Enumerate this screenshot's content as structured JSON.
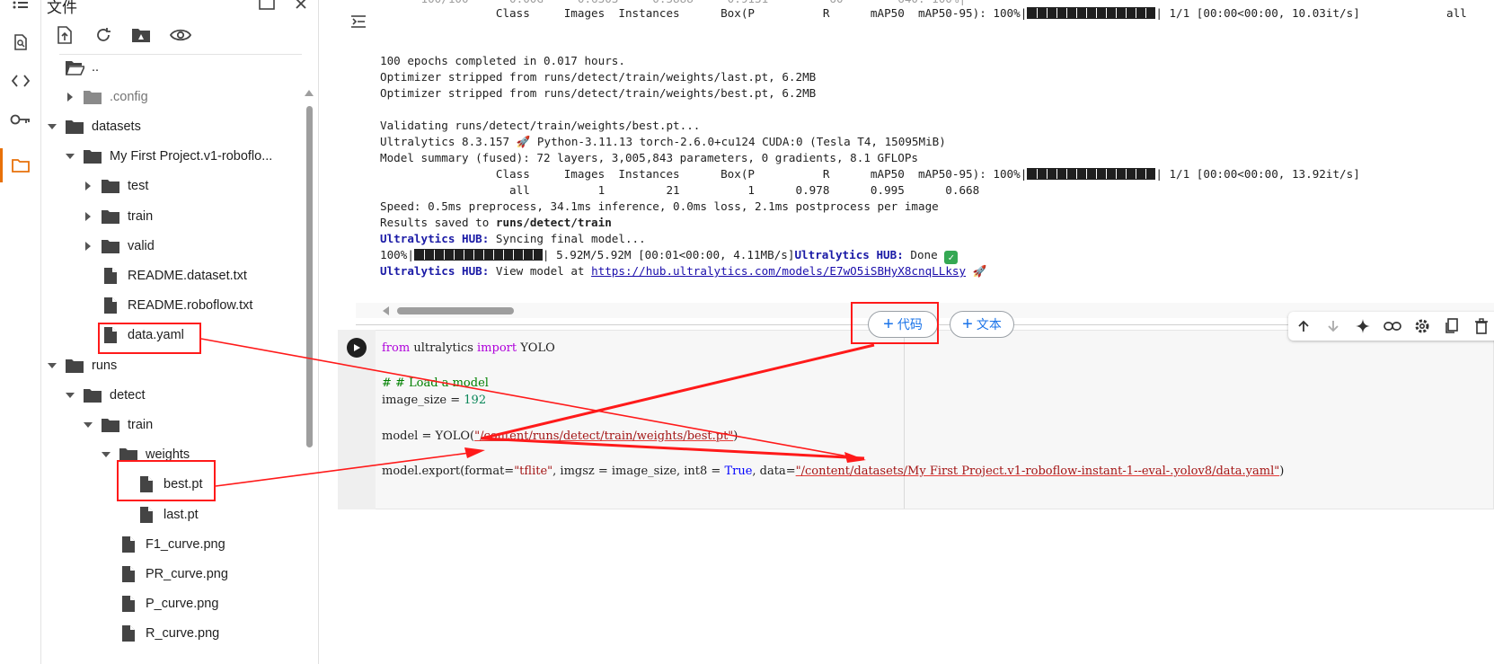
{
  "rail": {
    "icons": [
      "list-icon",
      "search-doc-icon",
      "code-icon",
      "key-icon",
      "folder-icon"
    ]
  },
  "files": {
    "title": "文件",
    "toolbar": [
      "upload-file-icon",
      "refresh-icon",
      "drive-folder-icon",
      "eye-icon"
    ],
    "tree": [
      {
        "label": "..",
        "type": "folder-open"
      },
      {
        "label": ".config",
        "type": "folder",
        "grey": true,
        "caret": "right"
      },
      {
        "label": "datasets",
        "type": "folder",
        "caret": "down"
      },
      {
        "label": "My First Project.v1-roboflo...",
        "type": "folder",
        "caret": "down"
      },
      {
        "label": "test",
        "type": "folder",
        "caret": "right"
      },
      {
        "label": "train",
        "type": "folder",
        "caret": "right"
      },
      {
        "label": "valid",
        "type": "folder",
        "caret": "right"
      },
      {
        "label": "README.dataset.txt",
        "type": "file"
      },
      {
        "label": "README.roboflow.txt",
        "type": "file"
      },
      {
        "label": "data.yaml",
        "type": "file"
      },
      {
        "label": "runs",
        "type": "folder",
        "caret": "down"
      },
      {
        "label": "detect",
        "type": "folder",
        "caret": "down"
      },
      {
        "label": "train",
        "type": "folder",
        "caret": "down"
      },
      {
        "label": "weights",
        "type": "folder",
        "caret": "down"
      },
      {
        "label": "best.pt",
        "type": "file"
      },
      {
        "label": "last.pt",
        "type": "file"
      },
      {
        "label": "F1_curve.png",
        "type": "file"
      },
      {
        "label": "PR_curve.png",
        "type": "file"
      },
      {
        "label": "P_curve.png",
        "type": "file"
      },
      {
        "label": "R_curve.png",
        "type": "file"
      }
    ]
  },
  "output": {
    "lines": {
      "l0": "                 Class     Images  Instances      Box(P          R      mAP50  mAP50-95): 100%|",
      "l0b": "| 1/1 [00:00<00:00, 10.03it/s]",
      "l0c": "all",
      "l1": "100 epochs completed in 0.017 hours.",
      "l2": "Optimizer stripped from runs/detect/train/weights/last.pt, 6.2MB",
      "l3": "Optimizer stripped from runs/detect/train/weights/best.pt, 6.2MB",
      "l4": "Validating runs/detect/train/weights/best.pt...",
      "l5": "Ultralytics 8.3.157 🚀 Python-3.11.13 torch-2.6.0+cu124 CUDA:0 (Tesla T4, 15095MiB)",
      "l6": "Model summary (fused): 72 layers, 3,005,843 parameters, 0 gradients, 8.1 GFLOPs",
      "l7": "                 Class     Images  Instances      Box(P          R      mAP50  mAP50-95): 100%|",
      "l7b": "| 1/1 [00:00<00:00, 13.92it/s]",
      "l8": "                   all          1         21          1      0.978      0.995      0.668",
      "l9": "Speed: 0.5ms preprocess, 34.1ms inference, 0.0ms loss, 2.1ms postprocess per image",
      "l10a": "Results saved to ",
      "l10b": "runs/detect/train",
      "l11a": "Ultralytics HUB:",
      "l11b": " Syncing final model...",
      "l12a": "100%|",
      "l12b": "| 5.92M/5.92M [00:01<00:00, 4.11MB/s]",
      "l12c": "Ultralytics HUB:",
      "l12d": " Done ",
      "l13a": "Ultralytics HUB:",
      "l13b": " View model at ",
      "l13c": "https://hub.ultralytics.com/models/E7wO5iSBHyX8cnqLLksy",
      "l13d": " 🚀"
    }
  },
  "buttons": {
    "add_code": "代码",
    "add_text": "文本"
  },
  "cell_toolbar": [
    "arrow-up-icon",
    "arrow-down-icon",
    "gemini-sparkle-icon",
    "link-icon",
    "gear-icon",
    "mirror-cell-icon",
    "delete-icon"
  ],
  "code": {
    "line1": {
      "a": "from",
      "b": " ultralytics ",
      "c": "import",
      "d": " YOLO"
    },
    "line2": "# # Load a model",
    "line3": {
      "a": "image_size = ",
      "b": "192"
    },
    "line4": {
      "a": "model = YOLO(",
      "b": "\"/content/runs/detect/train/weights/best.pt\"",
      "c": ")"
    },
    "line5": {
      "a": "model.export(format=",
      "b": "\"tflite\"",
      "c": ", imgsz = image_size, int8 = ",
      "d": "True",
      "e": ", data=",
      "f": "\"/content/datasets/My First Project.v1-roboflow-instant-1--eval-.yolov8/data.yaml\"",
      "g": ")"
    }
  },
  "colors": {
    "annotation_red": "#ff1a1a",
    "accent_orange": "#e8710a",
    "link_blue": "#1a73e8"
  }
}
